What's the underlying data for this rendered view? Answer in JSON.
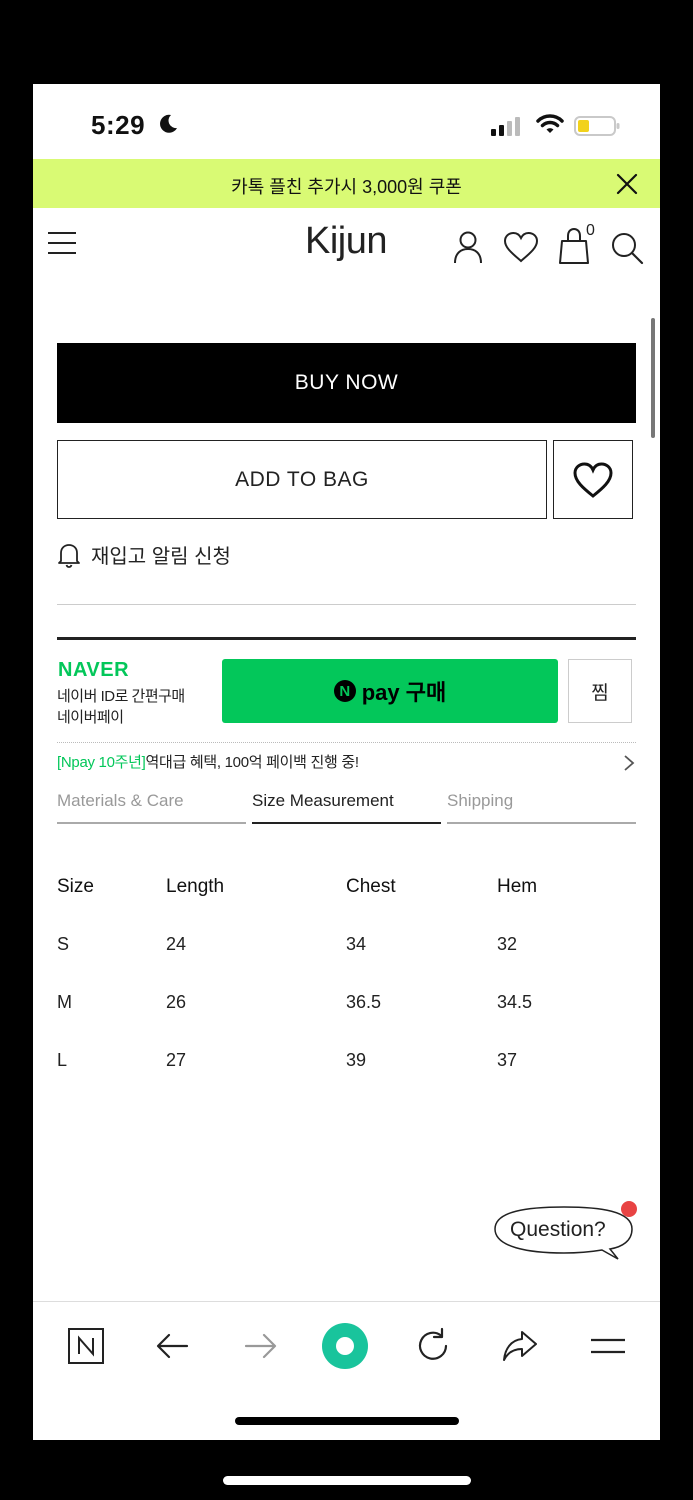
{
  "status_bar": {
    "time": "5:29",
    "icons": [
      "moon-icon",
      "signal-icon",
      "wifi-icon",
      "battery-icon"
    ]
  },
  "banner": {
    "text": "카톡 플친 추가시 3,000원 쿠폰",
    "background": "#d9fa74"
  },
  "header": {
    "logo": "Kijun",
    "cart_count": "0"
  },
  "actions": {
    "buy_now": "BUY NOW",
    "add_to_bag": "ADD TO BAG",
    "restock_alert": "재입고 알림 신청"
  },
  "naver_pay": {
    "brand": "NAVER",
    "line1": "네이버 ID로 간편구매",
    "line2": "네이버페이",
    "pay_button_n": "N",
    "pay_button_label": "pay 구매",
    "jjim_label": "찜",
    "promo_highlight": "[Npay 10주년]",
    "promo_text": "역대급 혜택, 100억 페이백 진행 중!",
    "brand_color": "#03c75a"
  },
  "tabs": [
    {
      "label": "Materials & Care",
      "active": false
    },
    {
      "label": "Size Measurement",
      "active": true
    },
    {
      "label": "Shipping",
      "active": false
    }
  ],
  "size_table": {
    "headers": [
      "Size",
      "Length",
      "Chest",
      "Hem"
    ],
    "rows": [
      [
        "S",
        "24",
        "34",
        "32"
      ],
      [
        "M",
        "26",
        "36.5",
        "34.5"
      ],
      [
        "L",
        "27",
        "39",
        "37"
      ]
    ]
  },
  "question_bubble": {
    "label": "Question?"
  },
  "browser_bar": {
    "icons": [
      "naver-n-icon",
      "back-arrow-icon",
      "forward-arrow-icon",
      "home-circle-icon",
      "reload-icon",
      "share-icon",
      "menu-lines-icon"
    ]
  }
}
